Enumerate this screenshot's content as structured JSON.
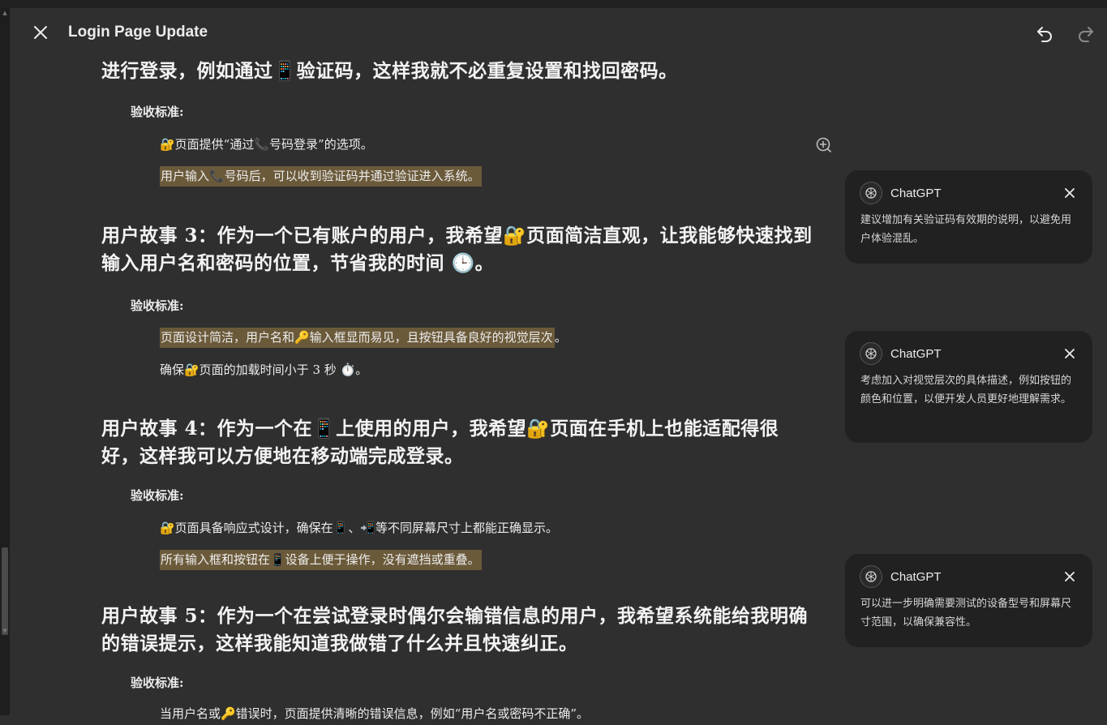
{
  "header": {
    "title": "Login Page Update"
  },
  "document": {
    "line0": "进行登录，例如通过📱验证码，这样我就不必重复设置和找回密码。",
    "criteria_label": "验收标准:",
    "story2_items": [
      "🔐页面提供“通过📞号码登录”的选项。",
      "用户输入📞号码后，可以收到验证码并通过验证进入系统。"
    ],
    "story3_title": "用户故事 3：作为一个已有账户的用户，我希望🔐页面简洁直观，让我能够快速找到输入用户名和密码的位置，节省我的时间 🕒。",
    "story3_items": [
      "页面设计简洁，用户名和🔑输入框显而易见，且按钮具备良好的视觉层次",
      "。",
      "确保🔐页面的加载时间小于 3 秒 ⏱️。"
    ],
    "story4_title": "用户故事 4：作为一个在📱上使用的用户，我希望🔐页面在手机上也能适配得很好，这样我可以方便地在移动端完成登录。",
    "story4_items": [
      "🔐页面具备响应式设计，确保在📱、📲等不同屏幕尺寸上都能正确显示。",
      "所有输入框和按钮在📱设备上便于操作，没有遮挡或重叠。"
    ],
    "story5_title": "用户故事 5：作为一个在尝试登录时偶尔会输错信息的用户，我希望系统能给我明确的错误提示，这样我能知道我做错了什么并且快速纠正。",
    "story5_items": [
      "当用户名或🔑错误时，页面提供清晰的错误信息，例如“用户名或密码不正确”。"
    ]
  },
  "comments": [
    {
      "author": "ChatGPT",
      "text": "建议增加有关验证码有效期的说明，以避免用户体验混乱。"
    },
    {
      "author": "ChatGPT",
      "text": "考虑加入对视觉层次的具体描述，例如按钮的颜色和位置，以便开发人员更好地理解需求。"
    },
    {
      "author": "ChatGPT",
      "text": "可以进一步明确需要测试的设备型号和屏幕尺寸范围，以确保兼容性。"
    }
  ],
  "colors": {
    "background": "#2f2f2f",
    "card": "#212121",
    "highlight": "#6b5a3a"
  },
  "icons": {
    "close": "close-icon",
    "undo": "undo-icon",
    "redo": "redo-icon",
    "add_comment": "add-comment-icon",
    "avatar": "chatgpt-logo-icon"
  }
}
